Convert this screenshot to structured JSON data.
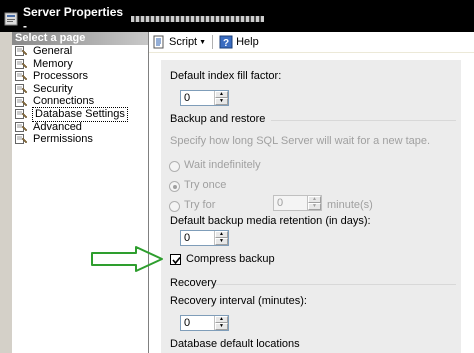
{
  "window": {
    "title": "Server Properties - "
  },
  "sidebar": {
    "header": "Select a page",
    "items": [
      {
        "label": "General",
        "icon": "page-wrench-icon"
      },
      {
        "label": "Memory",
        "icon": "page-wrench-icon"
      },
      {
        "label": "Processors",
        "icon": "page-wrench-icon"
      },
      {
        "label": "Security",
        "icon": "page-wrench-icon"
      },
      {
        "label": "Connections",
        "icon": "page-wrench-icon"
      },
      {
        "label": "Database Settings",
        "icon": "page-wrench-icon",
        "selected": true
      },
      {
        "label": "Advanced",
        "icon": "page-wrench-icon"
      },
      {
        "label": "Permissions",
        "icon": "page-wrench-icon"
      }
    ]
  },
  "toolbar": {
    "script_label": "Script",
    "help_label": "Help"
  },
  "settings": {
    "fill_factor_label": "Default index fill factor:",
    "fill_factor_value": "0",
    "backup_section": "Backup and restore",
    "tape_desc": "Specify how long SQL Server will wait for a new tape.",
    "wait_indefinitely": "Wait indefinitely",
    "try_once": "Try once",
    "try_for": "Try for",
    "try_for_value": "0",
    "minutes_unit": "minute(s)",
    "retention_label": "Default backup media retention (in days):",
    "retention_value": "0",
    "compress_backup": "Compress backup",
    "compress_checked": true,
    "recovery_section": "Recovery",
    "recovery_interval_label": "Recovery interval (minutes):",
    "recovery_interval_value": "0",
    "db_locations_section": "Database default locations"
  },
  "colors": {
    "arrow_outline": "#2e9e2e",
    "window_bg": "#d4d0c8",
    "title_bg": "#000000"
  }
}
